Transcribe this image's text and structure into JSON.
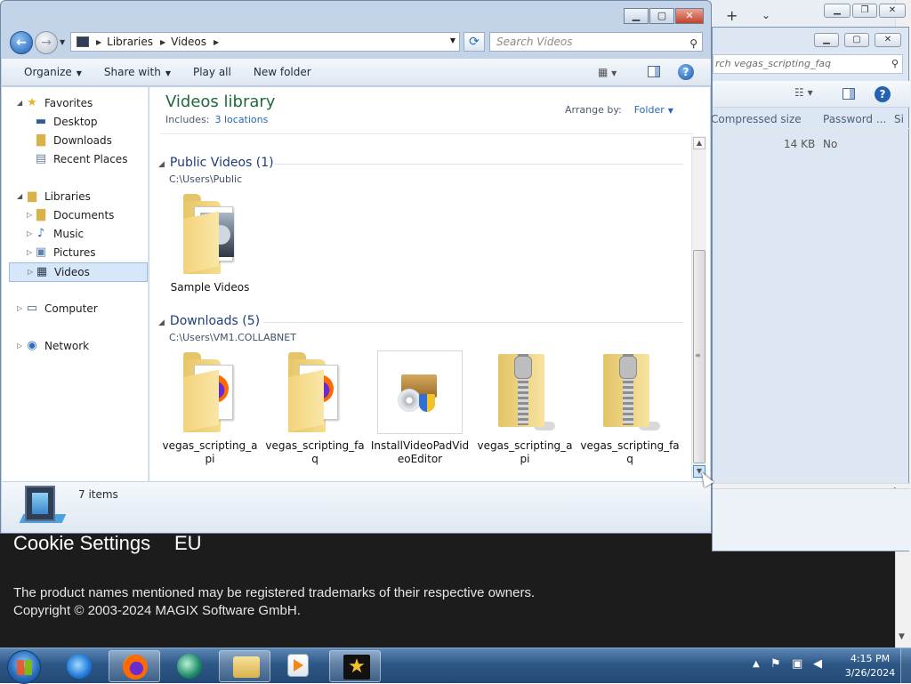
{
  "background_page": {
    "cookie_settings": "Cookie Settings",
    "eu_label": "EU",
    "trademark_text": "The product names mentioned may be registered trademarks of their respective owners.",
    "copyright_text": "Copyright © 2003-2024 MAGIX Software GmbH."
  },
  "zip_window": {
    "search_placeholder": "rch vegas_scripting_faq",
    "col_compressed": "Compressed size",
    "col_password": "Password ...",
    "col_size_partial": "Si",
    "row_compressed": "14 KB",
    "row_password": "No"
  },
  "explorer": {
    "title_buttons": {
      "minimize": "▁",
      "maximize": "▢",
      "close": "✕"
    },
    "address": {
      "root_icon": "videos-library-icon",
      "segments": [
        "Libraries",
        "Videos"
      ]
    },
    "search_placeholder": "Search Videos",
    "toolbar": {
      "organize": "Organize",
      "share_with": "Share with",
      "play_all": "Play all",
      "new_folder": "New folder",
      "help": "?"
    },
    "nav": {
      "favorites": "Favorites",
      "desktop": "Desktop",
      "downloads": "Downloads",
      "recent_places": "Recent Places",
      "libraries": "Libraries",
      "documents": "Documents",
      "music": "Music",
      "pictures": "Pictures",
      "videos": "Videos",
      "computer": "Computer",
      "network": "Network"
    },
    "library": {
      "title": "Videos library",
      "includes_label": "Includes:",
      "locations": "3 locations",
      "arrange_by": "Arrange by:",
      "arrange_value": "Folder"
    },
    "groups": [
      {
        "title": "Public Videos (1)",
        "path": "C:\\Users\\Public",
        "items": [
          {
            "label": "Sample Videos",
            "type": "folder-photo"
          }
        ]
      },
      {
        "title": "Downloads (5)",
        "path": "C:\\Users\\VM1.COLLABNET",
        "items": [
          {
            "label": "vegas_scripting_api",
            "type": "folder-firefox"
          },
          {
            "label": "vegas_scripting_faq",
            "type": "folder-firefox"
          },
          {
            "label": "InstallVideoPadVideoEditor",
            "type": "installer"
          },
          {
            "label": "vegas_scripting_api",
            "type": "zip"
          },
          {
            "label": "vegas_scripting_faq",
            "type": "zip"
          }
        ]
      }
    ],
    "status": "7 items"
  },
  "taskbar": {
    "apps": [
      "internet-explorer",
      "firefox",
      "app-circle",
      "windows-explorer",
      "media-player",
      "movie-maker"
    ],
    "time": "4:15 PM",
    "date": "3/26/2024"
  },
  "colors": {
    "library_title": "#1e6a39",
    "link_blue": "#2667b6",
    "group_title": "#1e3d78",
    "taskbar": "#2d5786"
  }
}
